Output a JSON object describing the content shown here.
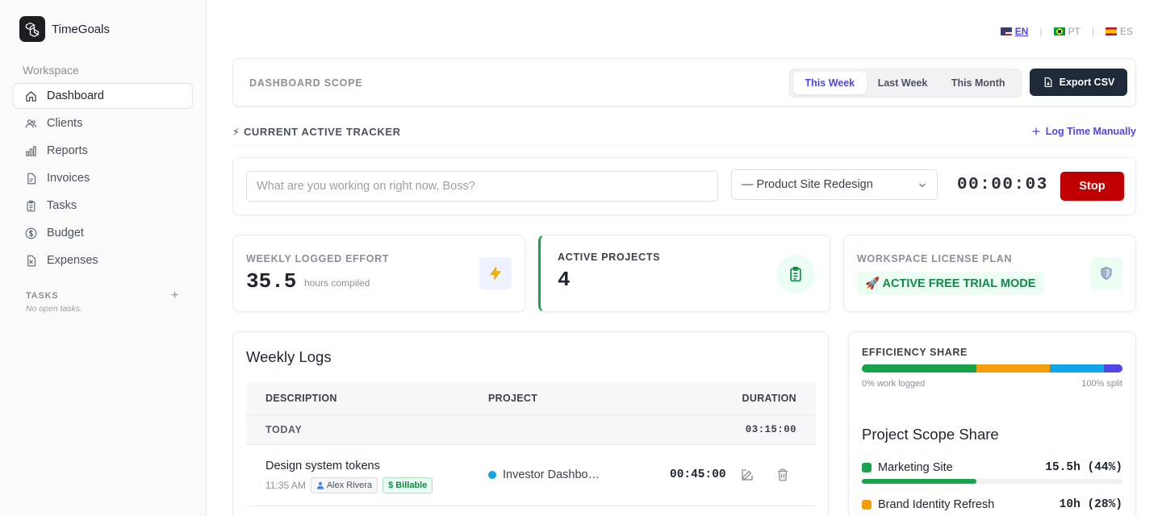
{
  "brand": {
    "name": "TimeGoals"
  },
  "sidebar": {
    "workspace_label": "Workspace",
    "items": [
      {
        "label": "Dashboard",
        "icon": "home-icon",
        "active": true
      },
      {
        "label": "Clients",
        "icon": "users-icon"
      },
      {
        "label": "Reports",
        "icon": "bar-chart-icon"
      },
      {
        "label": "Invoices",
        "icon": "file-icon"
      },
      {
        "label": "Tasks",
        "icon": "clipboard-icon"
      },
      {
        "label": "Budget",
        "icon": "dollar-icon"
      },
      {
        "label": "Expenses",
        "icon": "receipt-icon"
      }
    ],
    "tasks_heading": "TASKS",
    "tasks_add": "+",
    "tasks_empty": "No open tasks."
  },
  "lang": {
    "en": "EN",
    "pt": "PT",
    "es": "ES",
    "active": "EN"
  },
  "scope": {
    "label": "DASHBOARD SCOPE",
    "options": [
      "This Week",
      "Last Week",
      "This Month"
    ],
    "selected": "This Week",
    "export_label": "Export CSV"
  },
  "tracker": {
    "title": "⚡ CURRENT ACTIVE TRACKER",
    "log_manual": "Log Time Manually",
    "placeholder": "What are you working on right now, Boss?",
    "project": "— Product Site Redesign",
    "timer": "00:00:03",
    "stop_label": "Stop"
  },
  "stats": {
    "weekly": {
      "label": "WEEKLY LOGGED EFFORT",
      "value": "35.5",
      "unit": "hours compiled"
    },
    "projects": {
      "label": "ACTIVE PROJECTS",
      "value": "4"
    },
    "license": {
      "label": "WORKSPACE LICENSE PLAN",
      "badge": "🚀 ACTIVE FREE TRIAL MODE"
    }
  },
  "logs": {
    "title": "Weekly Logs",
    "columns": {
      "description": "DESCRIPTION",
      "project": "PROJECT",
      "duration": "DURATION"
    },
    "groups": [
      {
        "label": "TODAY",
        "duration": "03:15:00",
        "rows": [
          {
            "description": "Design system tokens",
            "time": "11:35 AM",
            "user": "Alex Rivera",
            "billable": "$ Billable",
            "project": "Investor Dashbo…",
            "project_color": "#0ea5e9",
            "duration": "00:45:00"
          }
        ]
      }
    ]
  },
  "efficiency": {
    "label": "EFFICIENCY SHARE",
    "left": "0% work logged",
    "right": "100% split",
    "segments": [
      {
        "share": 44,
        "color": "#16a34a"
      },
      {
        "share": 28,
        "color": "#f59e0b"
      },
      {
        "share": 21,
        "color": "#0ea5e9"
      },
      {
        "share": 7,
        "color": "#4f46e5"
      }
    ]
  },
  "project_share": {
    "title": "Project Scope Share",
    "items": [
      {
        "name": "Marketing Site",
        "value": "15.5h (44%)",
        "share": 44,
        "color": "#16a34a"
      },
      {
        "name": "Brand Identity Refresh",
        "value": "10h (28%)",
        "share": 28,
        "color": "#f59e0b"
      }
    ]
  }
}
